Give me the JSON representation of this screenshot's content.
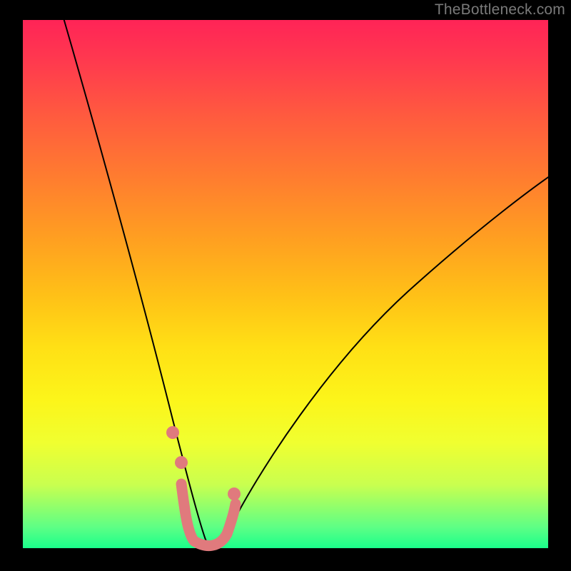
{
  "watermark": {
    "text": "TheBottleneck.com"
  },
  "colors": {
    "frame": "#000000",
    "curve": "#000000",
    "highlight": "#e07a7d",
    "gradient_stops": [
      "#ff2457",
      "#ff3a4e",
      "#ff5a3f",
      "#ff7d2f",
      "#ffa120",
      "#ffc017",
      "#ffe015",
      "#fcf51a",
      "#f0ff30",
      "#c9ff4f",
      "#5eff85",
      "#1aff8b"
    ]
  },
  "chart_data": {
    "type": "line",
    "title": "",
    "xlabel": "",
    "ylabel": "",
    "xlim": [
      0,
      100
    ],
    "ylim": [
      0,
      100
    ],
    "grid": false,
    "legend": false,
    "series": [
      {
        "name": "bottleneck-curve",
        "x": [
          5,
          10,
          15,
          20,
          23,
          26,
          28,
          30,
          32,
          34,
          36,
          38,
          40,
          45,
          50,
          55,
          60,
          65,
          70,
          75,
          80,
          85,
          90,
          95,
          100
        ],
        "y": [
          100,
          76,
          54,
          34,
          23,
          14,
          8,
          4,
          1.5,
          0.5,
          0.3,
          0.8,
          2,
          8,
          16,
          24,
          31,
          38,
          44,
          49,
          54,
          58,
          62,
          65,
          68
        ]
      }
    ],
    "highlight": {
      "name": "minimum-region",
      "x": [
        28,
        30,
        32,
        34,
        36,
        38,
        40
      ],
      "y": [
        9,
        4,
        1.5,
        0.5,
        0.5,
        2,
        6
      ]
    }
  }
}
